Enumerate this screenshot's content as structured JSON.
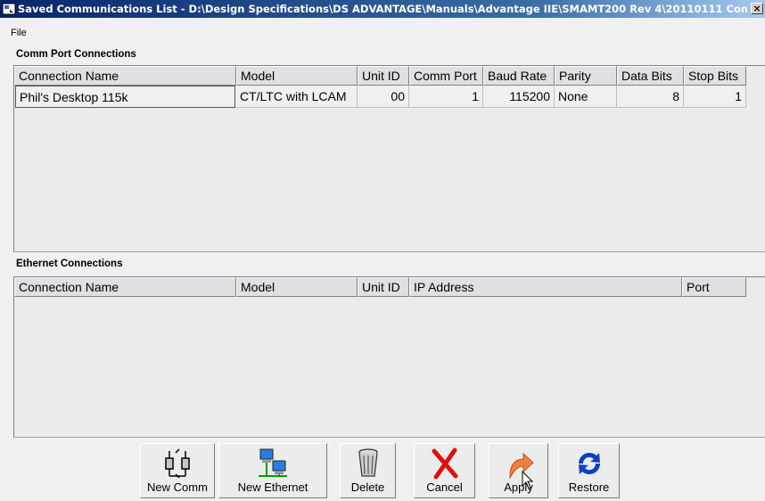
{
  "window": {
    "title": "Saved Communications List - D:\\Design Specifications\\DS ADVANTAGE\\Manuals\\Advantage IIE\\SMAMT200 Rev 4\\20110111 Com...",
    "close_glyph": "×"
  },
  "menu": {
    "file": "File"
  },
  "comm": {
    "section_label": "Comm Port Connections",
    "columns": [
      "Connection Name",
      "Model",
      "Unit ID",
      "Comm Port",
      "Baud Rate",
      "Parity",
      "Data Bits",
      "Stop Bits"
    ],
    "rows": [
      {
        "name": "Phil's Desktop 115k",
        "model": "CT/LTC with LCAM",
        "unit_id": "00",
        "comm_port": "1",
        "baud_rate": "115200",
        "parity": "None",
        "data_bits": "8",
        "stop_bits": "1"
      }
    ]
  },
  "ethernet": {
    "section_label": "Ethernet Connections",
    "columns": [
      "Connection Name",
      "Model",
      "Unit ID",
      "IP Address",
      "Port"
    ],
    "rows": []
  },
  "toolbar": {
    "new_comm": "New Comm",
    "new_ethernet": "New Ethernet",
    "delete": "Delete",
    "cancel": "Cancel",
    "apply": "Apply",
    "restore": "Restore"
  },
  "colors": {
    "title_bar": "#0a246a",
    "cancel_icon": "#e01010",
    "apply_icon": "#f08040",
    "restore_icon": "#1040c0"
  }
}
